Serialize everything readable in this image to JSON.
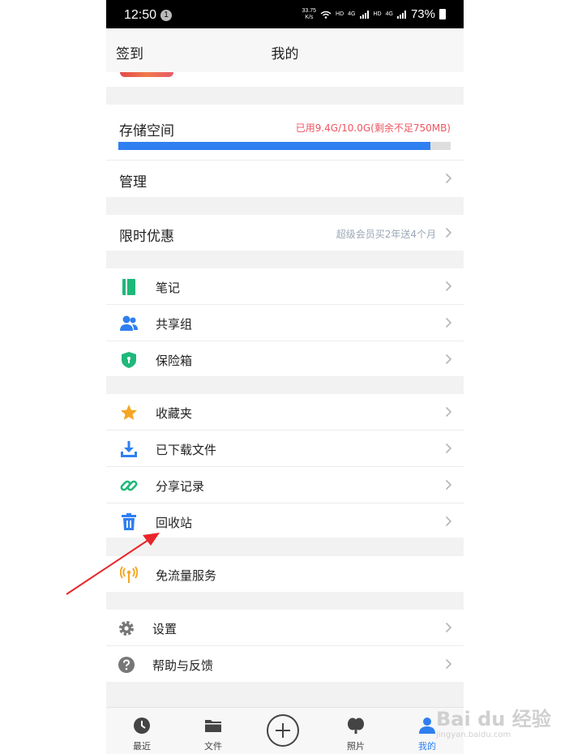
{
  "status_bar": {
    "time": "12:50",
    "notification_count": "1",
    "speed": "33.75",
    "speed_unit": "K/s",
    "hd1": "HD",
    "net1": "4G",
    "hd2": "HD",
    "net2": "4G",
    "battery": "73%"
  },
  "header": {
    "left_action": "签到",
    "title": "我的"
  },
  "storage": {
    "title": "存储空间",
    "used_text": "已用9.4G/10.0G(剩余不足750MB)",
    "used_fraction": 0.94,
    "manage_label": "管理"
  },
  "promo": {
    "label": "限时优惠",
    "detail": "超级会员买2年送4个月"
  },
  "tools": [
    {
      "label": "笔记",
      "icon": "notebook-icon"
    },
    {
      "label": "共享组",
      "icon": "users-icon"
    },
    {
      "label": "保险箱",
      "icon": "shield-icon"
    }
  ],
  "files": [
    {
      "label": "收藏夹",
      "icon": "star-icon"
    },
    {
      "label": "已下载文件",
      "icon": "download-icon"
    },
    {
      "label": "分享记录",
      "icon": "link-icon"
    },
    {
      "label": "回收站",
      "icon": "trash-icon"
    }
  ],
  "free_data": {
    "label": "免流量服务",
    "icon": "antenna-icon"
  },
  "settings": [
    {
      "label": "设置",
      "icon": "gear-icon"
    },
    {
      "label": "帮助与反馈",
      "icon": "help-icon"
    }
  ],
  "bottom_nav": {
    "recent": "最近",
    "files": "文件",
    "photos": "照片",
    "mine": "我的"
  },
  "watermark": {
    "main": "Bai du 经验",
    "sub": "jingyan.baidu.com"
  },
  "colors": {
    "accent": "#2f7ff0",
    "warning": "#f0545f",
    "green": "#1fb87a",
    "orange": "#f5a623",
    "gray_icon": "#777777"
  }
}
